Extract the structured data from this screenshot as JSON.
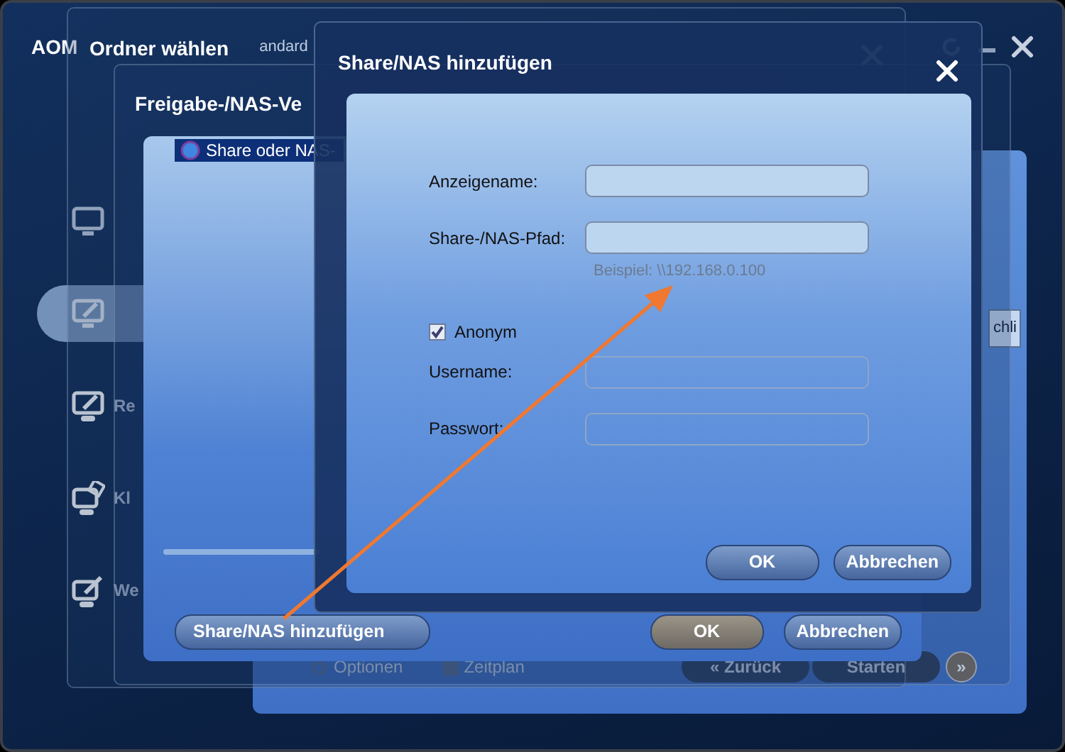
{
  "app_window": {
    "title": "AOM",
    "subtitle": "andard",
    "sidebar": [
      {
        "selected": false
      },
      {
        "selected": true
      },
      {
        "label": "Re",
        "selected": false
      },
      {
        "label": "Kl",
        "selected": false
      },
      {
        "label": "We",
        "selected": false
      }
    ],
    "side_tab": "chli",
    "footer": {
      "options": "Optionen",
      "schedule": "Zeitplan",
      "back": "« Zurück",
      "start": "Starten",
      "next": "»"
    }
  },
  "folder_dialog": {
    "title": "Ordner wählen"
  },
  "nas_manager": {
    "title": "Freigabe-/NAS-Ve",
    "tree": [
      {
        "label": "Share oder NAS-",
        "selected": true
      }
    ],
    "add_button": "Share/NAS hinzufügen",
    "ok_button": "OK",
    "cancel_button": "Abbrechen"
  },
  "add_dialog": {
    "title": "Share/NAS hinzufügen",
    "rows": [
      {
        "kind": "field",
        "label": "Anzeigename:",
        "disabled": false
      },
      {
        "kind": "field",
        "label": "Share-/NAS-Pfad:",
        "disabled": false,
        "hint": "Beispiel: \\\\192.168.0.100"
      },
      {
        "kind": "checkbox",
        "label": "Anonym",
        "checked": true
      },
      {
        "kind": "field",
        "label": "Username:",
        "disabled": true
      },
      {
        "kind": "field",
        "label": "Passwort:",
        "disabled": true
      }
    ],
    "buttons": [
      "OK",
      "Abbrechen"
    ]
  }
}
